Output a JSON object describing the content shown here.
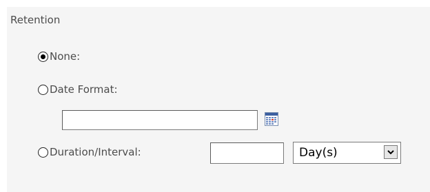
{
  "retention": {
    "section_label": "Retention",
    "options": {
      "none_label": "None:",
      "date_format_label": "Date Format:",
      "duration_label": "Duration/Interval:"
    },
    "selected_option": "none",
    "date_format_value": "",
    "duration_value": "",
    "unit_select": {
      "selected": "Day(s)"
    },
    "icons": {
      "calendar": "calendar-icon",
      "dropdown": "chevron-down-icon"
    }
  },
  "colors": {
    "panel_background": "#f5f5f5",
    "text": "#4c4c4c"
  }
}
